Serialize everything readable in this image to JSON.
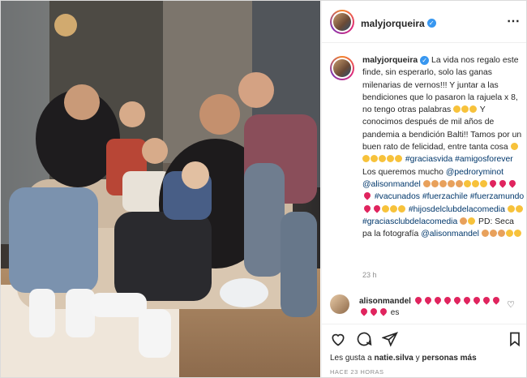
{
  "post": {
    "username": "malyjorqueira",
    "more_icon": "ellipsis-icon",
    "caption_parts": [
      "La vida nos regalo este finde, sin esperarlo, solo las ganas milenarias de vernos!!! Y juntar a las bendiciones que lo pasaron la rajuela x 8, no tengo otras palabras",
      "Y conocimos después de mil años de pandemia a bendición Balti!! Tamos por un buen rato de felicidad, entre tanta cosa",
      "#graciasvida",
      "#amigosforever",
      "Los queremos mucho",
      "@pedrorуminot",
      "@alisonmandel",
      "#vacunados",
      "#fuerzachile",
      "#fuerzamundo",
      "#hijosdelclubdelacomedia",
      "#graciasclubdelacomedia",
      "PD: Seca pa la fotografía",
      "@alisonmandel"
    ],
    "time_ago": "23 h"
  },
  "comment": {
    "username": "alisonmandel",
    "text_suffix": "es"
  },
  "likes": {
    "prefix": "Les gusta a",
    "user": "natie.silva",
    "conj": "y",
    "others": "personas más"
  },
  "timestamp": "HACE 23 HORAS",
  "colors": {
    "link": "#00376b",
    "verified": "#3897f0",
    "heart": "#e0245e"
  }
}
